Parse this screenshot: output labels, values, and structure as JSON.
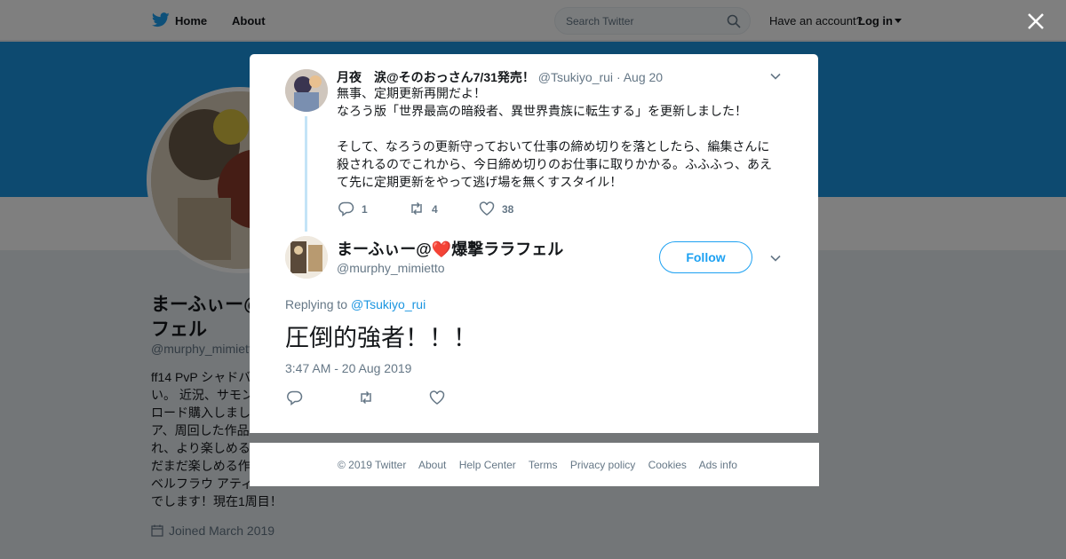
{
  "topbar": {
    "home_label": "Home",
    "about_label": "About",
    "search_placeholder": "Search Twitter",
    "have_account": "Have an account?",
    "login_label": "Log in"
  },
  "profile": {
    "name": "まーふぃー@❤️爆撃ララフェル",
    "name_visible": "まーふぃー@\nフェル",
    "handle": "@murphy_mimietto",
    "bio_visible": "ff14 PvP シャドバ\nい。 近況、サモン\nロード購入しまし\nア、周回した作品\nれ、より楽しめる\nだまだ楽しめる作\nベルフラウ アティ\nでします！現在1周目！",
    "joined": "Joined March 2019"
  },
  "original_tweet": {
    "name": "月夜　涙@そのおっさん7/31発売！",
    "handle": "@Tsukiyo_rui",
    "date": "· Aug 20",
    "text": "無事、定期更新再開だよ！\nなろう版「世界最高の暗殺者、異世界貴族に転生する」を更新しました！\n\nそして、なろうの更新守っておいて仕事の締め切りを落としたら、編集さんに殺されるのでこれから、今日締め切りのお仕事に取りかかる。ふふふっ、あえて先に定期更新をやって逃げ場を無くすスタイル！",
    "replies": "1",
    "retweets": "4",
    "likes": "38"
  },
  "reply_tweet": {
    "name_part1": "まーふぃー@",
    "name_heart": "❤️",
    "name_part2": "爆撃ララフェル",
    "handle": "@murphy_mimietto",
    "follow_label": "Follow",
    "replying_to_label": "Replying to",
    "replying_to_handle": "@Tsukiyo_rui",
    "text": "圧倒的強者！！！",
    "timestamp": "3:47 AM - 20 Aug 2019"
  },
  "footer": {
    "links": [
      "© 2019 Twitter",
      "About",
      "Help Center",
      "Terms",
      "Privacy policy",
      "Cookies",
      "Ads info"
    ]
  },
  "colors": {
    "accent": "#1da1f2",
    "banner": "#1b95e0",
    "muted": "#657786",
    "heart": "#e0245e"
  }
}
